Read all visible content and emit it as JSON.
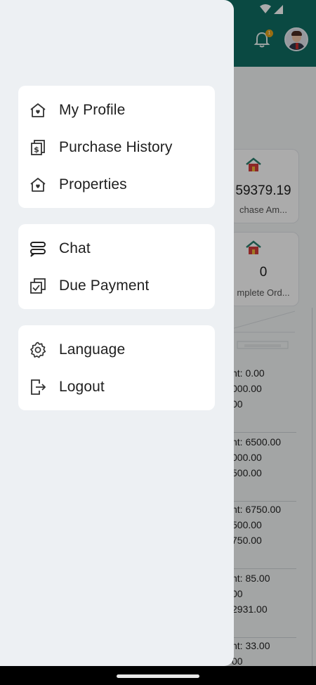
{
  "app": {
    "notification_badge": "1",
    "stats": [
      {
        "value": "59379.19",
        "label": "chase Am..."
      },
      {
        "value": "0",
        "label": "mplete Ord..."
      }
    ],
    "transactions": [
      {
        "line1": "nt: 0.00",
        "line2": "000.00",
        "line3": "00"
      },
      {
        "line1": "nt: 6500.00",
        "line2": "000.00",
        "line3": "500.00"
      },
      {
        "line1": "nt: 6750.00",
        "line2": "500.00",
        "line3": "750.00"
      },
      {
        "line1": "nt: 85.00",
        "line2": "00",
        "line3": "2931.00"
      },
      {
        "line1": "nt: 33.00",
        "line2": "00",
        "line3": ""
      }
    ],
    "colors": {
      "appbar": "#0f6e63",
      "badge": "#e5a21a"
    }
  },
  "drawer": {
    "groups": [
      {
        "items": [
          {
            "label": "My Profile",
            "icon": "home-heart-icon"
          },
          {
            "label": "Purchase History",
            "icon": "receipt-dollar-icon"
          },
          {
            "label": "Properties",
            "icon": "home-heart-icon"
          }
        ]
      },
      {
        "items": [
          {
            "label": "Chat",
            "icon": "chat-bubbles-icon"
          },
          {
            "label": "Due Payment",
            "icon": "checklist-icon"
          }
        ]
      },
      {
        "items": [
          {
            "label": "Language",
            "icon": "gear-icon"
          },
          {
            "label": "Logout",
            "icon": "logout-icon"
          }
        ]
      }
    ]
  }
}
